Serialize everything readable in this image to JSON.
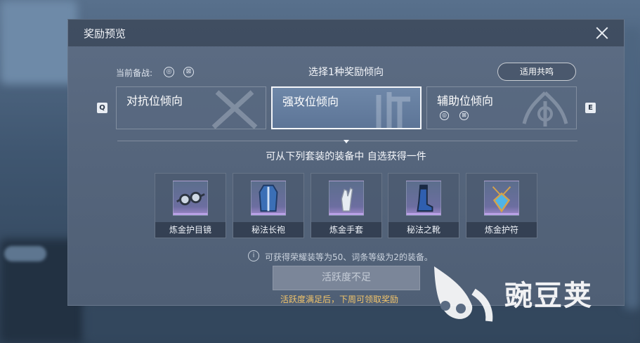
{
  "dialog": {
    "title": "奖励预览",
    "current_team_label": "当前备战:",
    "selection_title": "选择1种奖励倾向",
    "resonance_button": "适用共鸣",
    "key_left": "Q",
    "key_right": "E",
    "tendencies": [
      {
        "label": "对抗位倾向",
        "selected": false
      },
      {
        "label": "强攻位倾向",
        "selected": true
      },
      {
        "label": "辅助位倾向",
        "selected": false
      }
    ],
    "items_title": "可从下列套装的装备中 自选获得一件",
    "items": [
      {
        "name": "炼金护目镜",
        "icon": "goggles-icon"
      },
      {
        "name": "秘法长袍",
        "icon": "robe-icon"
      },
      {
        "name": "炼金手套",
        "icon": "glove-icon"
      },
      {
        "name": "秘法之靴",
        "icon": "boot-icon"
      },
      {
        "name": "炼金护符",
        "icon": "amulet-icon"
      }
    ],
    "info_text": "可获得荣耀装等为50、词条等级为2的装备。",
    "action_button": "活跃度不足",
    "warning_text": "活跃度满足后，下周可领取奖励"
  },
  "watermark": {
    "text": "豌豆荚"
  },
  "colors": {
    "warning": "#f0c36a",
    "selected_border": "#f4f6fa",
    "rarity_purple": "#b9a1e6"
  }
}
